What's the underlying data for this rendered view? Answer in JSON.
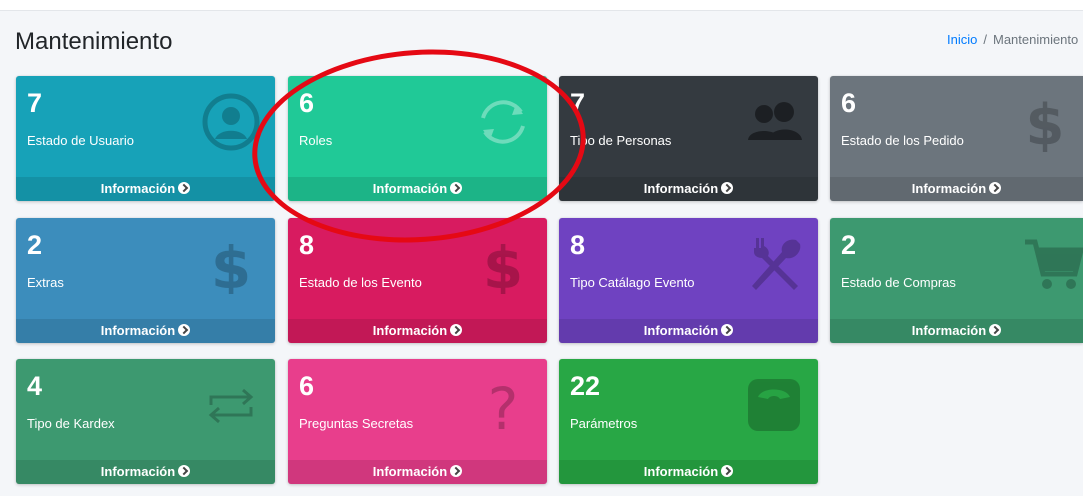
{
  "header": {
    "page_title": "Mantenimiento",
    "breadcrumb": {
      "home": "Inicio",
      "separator": "/",
      "current": "Mantenimiento"
    }
  },
  "footer_label": "Información",
  "boxes": [
    {
      "count": "7",
      "label": "Estado de Usuario",
      "icon": "user-circle-icon",
      "color": "#17a2b8"
    },
    {
      "count": "6",
      "label": "Roles",
      "icon": "sync-icon",
      "color": "#20c997"
    },
    {
      "count": "7",
      "label": "Tipo de Personas",
      "icon": "users-icon",
      "color": "#343a40"
    },
    {
      "count": "6",
      "label": "Estado de los Pedido",
      "icon": "dollar-icon",
      "color": "#6c757d"
    },
    {
      "count": "2",
      "label": "Extras",
      "icon": "dollar-icon",
      "color": "#3c8dbc"
    },
    {
      "count": "8",
      "label": "Estado de los Evento",
      "icon": "dollar-icon",
      "color": "#d81b60"
    },
    {
      "count": "8",
      "label": "Tipo Catálago Evento",
      "icon": "utensils-icon",
      "color": "#6f42c1"
    },
    {
      "count": "2",
      "label": "Estado de Compras",
      "icon": "cart-icon",
      "color": "#3d9970"
    },
    {
      "count": "4",
      "label": "Tipo de Kardex",
      "icon": "exchange-icon",
      "color": "#3d9970"
    },
    {
      "count": "6",
      "label": "Preguntas Secretas",
      "icon": "question-icon",
      "color": "#e83e8c"
    },
    {
      "count": "22",
      "label": "Parámetros",
      "icon": "weight-scale-icon",
      "color": "#28a745"
    }
  ]
}
